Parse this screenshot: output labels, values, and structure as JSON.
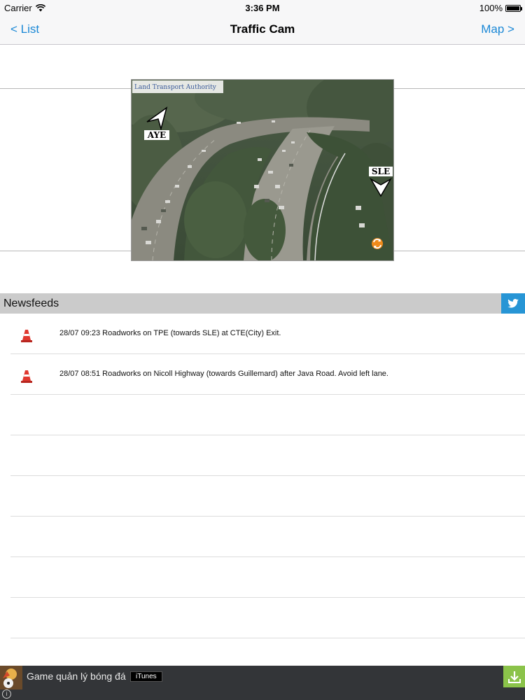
{
  "status_bar": {
    "carrier": "Carrier",
    "time": "3:36 PM",
    "battery": "100%",
    "battery_level": 1.0
  },
  "nav": {
    "back_label": "< List",
    "title": "Traffic Cam",
    "forward_label": "Map >"
  },
  "camera": {
    "watermark": "Land Transport Authority",
    "left_road_label": "AYE",
    "right_road_label": "SLE"
  },
  "newsfeeds": {
    "title": "Newsfeeds",
    "items": [
      {
        "text": "28/07 09:23 Roadworks on TPE (towards SLE) at CTE(City) Exit.",
        "icon": "traffic-cone-icon"
      },
      {
        "text": "28/07 08:51 Roadworks on Nicoll Highway (towards Guillemard) after Java Road. Avoid left lane.",
        "icon": "traffic-cone-icon"
      },
      {
        "text": ""
      },
      {
        "text": ""
      },
      {
        "text": ""
      },
      {
        "text": ""
      },
      {
        "text": ""
      },
      {
        "text": ""
      }
    ]
  },
  "ad": {
    "text": "Game quản lý bóng đá",
    "badge": "iTunes",
    "info": "i"
  },
  "colors": {
    "accent": "#1b88d6",
    "twitter": "#2795d5",
    "ad_bar": "#333538",
    "download": "#8bc34a"
  }
}
